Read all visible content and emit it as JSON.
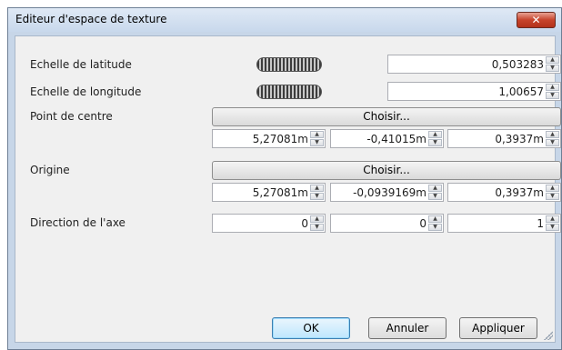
{
  "window": {
    "title": "Editeur d'espace de texture",
    "close_glyph": "✕"
  },
  "fields": {
    "latitude": {
      "label": "Echelle de latitude",
      "value": "0,503283"
    },
    "longitude": {
      "label": "Echelle de longitude",
      "value": "1,00657"
    },
    "center": {
      "label": "Point de centre",
      "button": "Choisir...",
      "x": "5,27081m",
      "y": "-0,41015m",
      "z": "0,3937m"
    },
    "origin": {
      "label": "Origine",
      "button": "Choisir...",
      "x": "5,27081m",
      "y": "-0,0939169m",
      "z": "0,3937m"
    },
    "axis": {
      "label": "Direction de l'axe",
      "x": "0",
      "y": "0",
      "z": "1"
    }
  },
  "buttons": {
    "ok": "OK",
    "cancel": "Annuler",
    "apply": "Appliquer"
  },
  "icons": {
    "spin_up": "▲",
    "spin_down": "▼"
  },
  "colors": {
    "frame": "#c7d6e8",
    "close": "#c7432b",
    "ok_border": "#3c7fb1"
  }
}
